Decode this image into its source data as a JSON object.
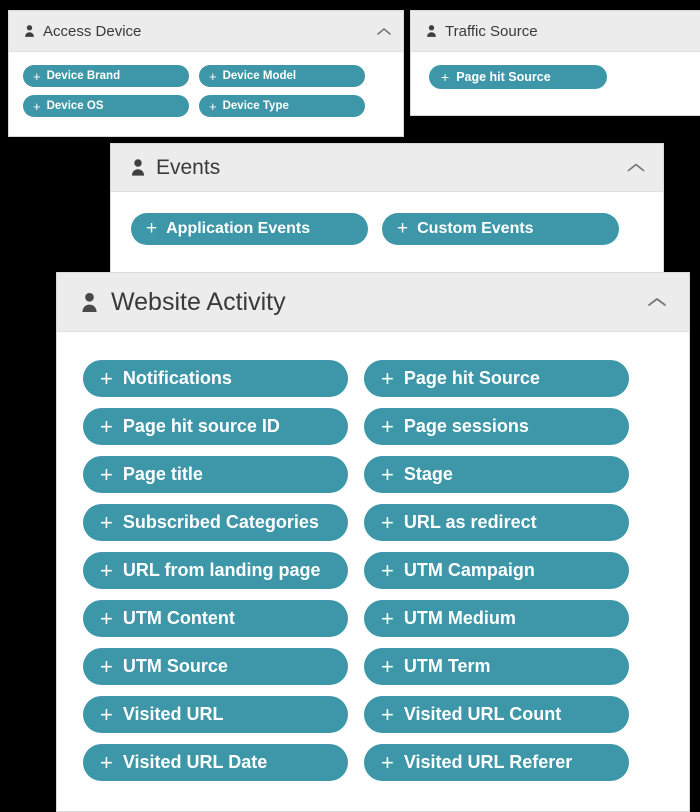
{
  "panels": [
    {
      "id": "access-device",
      "title": "Access Device",
      "icon": "user-icon",
      "collapse_icon": "chevron-up-icon",
      "buttons": [
        {
          "label": "Device Brand"
        },
        {
          "label": "Device Model"
        },
        {
          "label": "Device OS"
        },
        {
          "label": "Device Type"
        }
      ]
    },
    {
      "id": "traffic-source",
      "title": "Traffic Source",
      "icon": "user-icon",
      "collapse_icon": null,
      "buttons": [
        {
          "label": "Page hit Source"
        }
      ]
    },
    {
      "id": "events",
      "title": "Events",
      "icon": "user-icon",
      "collapse_icon": "chevron-up-icon",
      "buttons": [
        {
          "label": "Application Events"
        },
        {
          "label": "Custom Events"
        }
      ]
    },
    {
      "id": "website-activity",
      "title": "Website Activity",
      "icon": "user-icon",
      "collapse_icon": "chevron-up-icon",
      "buttons": [
        {
          "label": "Notifications"
        },
        {
          "label": "Page hit Source"
        },
        {
          "label": "Page hit source ID"
        },
        {
          "label": "Page sessions"
        },
        {
          "label": "Page title"
        },
        {
          "label": "Stage"
        },
        {
          "label": "Subscribed Categories"
        },
        {
          "label": "URL as redirect"
        },
        {
          "label": "URL from landing page"
        },
        {
          "label": "UTM Campaign"
        },
        {
          "label": "UTM Content"
        },
        {
          "label": "UTM Medium"
        },
        {
          "label": "UTM Source"
        },
        {
          "label": "UTM Term"
        },
        {
          "label": "Visited URL"
        },
        {
          "label": "Visited URL Count"
        },
        {
          "label": "Visited URL Date"
        },
        {
          "label": "Visited URL Referer"
        }
      ]
    }
  ],
  "symbols": {
    "plus": "+"
  },
  "colors": {
    "pill_background": "#3d97a8",
    "pill_text": "#ffffff",
    "panel_background": "#ffffff",
    "panel_header_background": "#ececec",
    "panel_title_text": "#3a3a3a",
    "page_background": "#000000"
  }
}
